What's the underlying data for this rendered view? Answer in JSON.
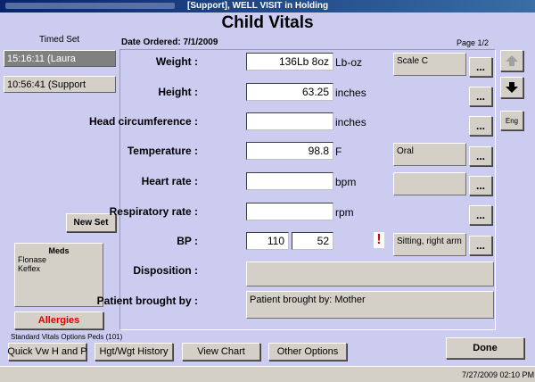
{
  "window": {
    "title": "[Support], WELL VISIT in Holding"
  },
  "page_title": "Child Vitals",
  "date_ordered": "Date Ordered:  7/1/2009",
  "page_indicator": "Page 1/2",
  "timed_set": {
    "label": "Timed Set",
    "items": [
      "15:16:11  (Laura",
      "10:56:41  (Support"
    ],
    "new_set_label": "New Set"
  },
  "meds": {
    "title": "Meds",
    "items": [
      "Flonase",
      "Keflex"
    ]
  },
  "allergies_label": "Allergies",
  "options_caption": "Standard Vitals Options Peds (101)",
  "vitals": {
    "weight": {
      "label": "Weight :",
      "value": "136Lb 8oz",
      "unit": "Lb-oz",
      "extra": "Scale C"
    },
    "height": {
      "label": "Height :",
      "value": "63.25",
      "unit": "inches"
    },
    "head": {
      "label": "Head circumference :",
      "value": "",
      "unit": "inches"
    },
    "temperature": {
      "label": "Temperature :",
      "value": "98.8",
      "unit": "F",
      "extra": "Oral"
    },
    "heart_rate": {
      "label": "Heart rate :",
      "value": "",
      "unit": "bpm",
      "extra": ""
    },
    "resp_rate": {
      "label": "Respiratory rate :",
      "value": "",
      "unit": "rpm"
    },
    "bp": {
      "label": "BP :",
      "systolic": "110",
      "diastolic": "52",
      "alert": "!",
      "extra": "Sitting, right arm"
    },
    "disposition": {
      "label": "Disposition :",
      "value": ""
    },
    "brought_by": {
      "label": "Patient brought by :",
      "value": "Patient brought by: Mother"
    }
  },
  "ellipsis": "...",
  "side": {
    "lang_label": "Eng"
  },
  "bottom_buttons": {
    "quick": "Quick Vw H and P",
    "history": "Hgt/Wgt History",
    "chart": "View Chart",
    "other": "Other Options",
    "done": "Done"
  },
  "status": {
    "datetime": "7/27/2009  02:10 PM"
  },
  "colors": {
    "background": "#ccccf0",
    "title_bar": "#08246b",
    "allergies": "#e00000",
    "alert": "#e00000"
  }
}
